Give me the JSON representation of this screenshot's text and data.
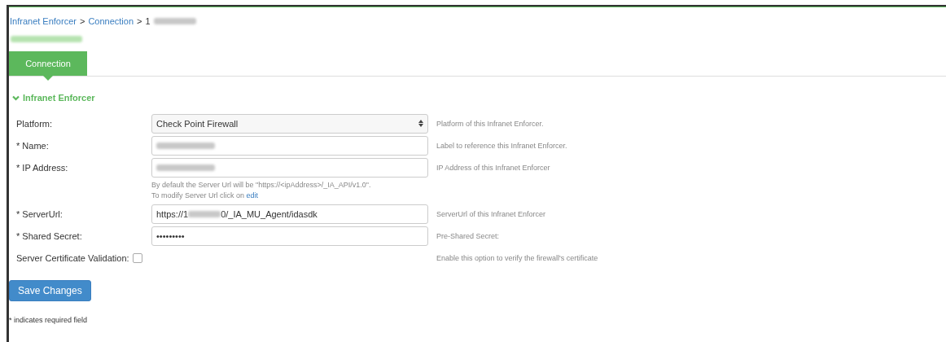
{
  "breadcrumb": [
    {
      "text": "Infranet Enforcer",
      "kind": "link"
    },
    {
      "text": ">",
      "kind": "separator"
    },
    {
      "text": "Connection",
      "kind": "link"
    },
    {
      "text": ">",
      "kind": "separator"
    },
    {
      "text": "1",
      "kind": "current",
      "redacted": true
    }
  ],
  "page_title": {
    "redacted": true
  },
  "tabs": [
    {
      "label": "Connection",
      "selected": true
    }
  ],
  "section": {
    "title": "Infranet Enforcer",
    "expanded": true
  },
  "fields": [
    {
      "kind": "select",
      "label": "Platform:",
      "value": "Check Point Firewall",
      "description": "Platform of this Infranet Enforcer."
    },
    {
      "kind": "text",
      "label": "* Name:",
      "redacted": true,
      "description": "Label to reference this Infranet Enforcer."
    },
    {
      "kind": "text",
      "label": "* IP Address:",
      "redacted": true,
      "description": "IP Address of this Infranet Enforcer",
      "help": [
        "By default the Server Url will be \"https://<ipAddress>/_IA_API/v1.0\"."
      ],
      "help_link_prefix": "To modify Server Url click on",
      "help_link": "edit"
    },
    {
      "kind": "text",
      "label": "* ServerUrl:",
      "value_start": "https://1",
      "redacted": true,
      "value_end": "0/_IA_MU_Agent/idasdk",
      "description": "ServerUrl of this Infranet Enforcer"
    },
    {
      "kind": "password",
      "label": "* Shared Secret:",
      "value": "•••••••••",
      "description": "Pre-Shared Secret:"
    },
    {
      "kind": "checkbox",
      "label": "Server Certificate Validation:",
      "checked": false,
      "description": "Enable this option to verify the firewall's certificate"
    }
  ],
  "save_button": "Save Changes",
  "footnote": "* indicates required field"
}
